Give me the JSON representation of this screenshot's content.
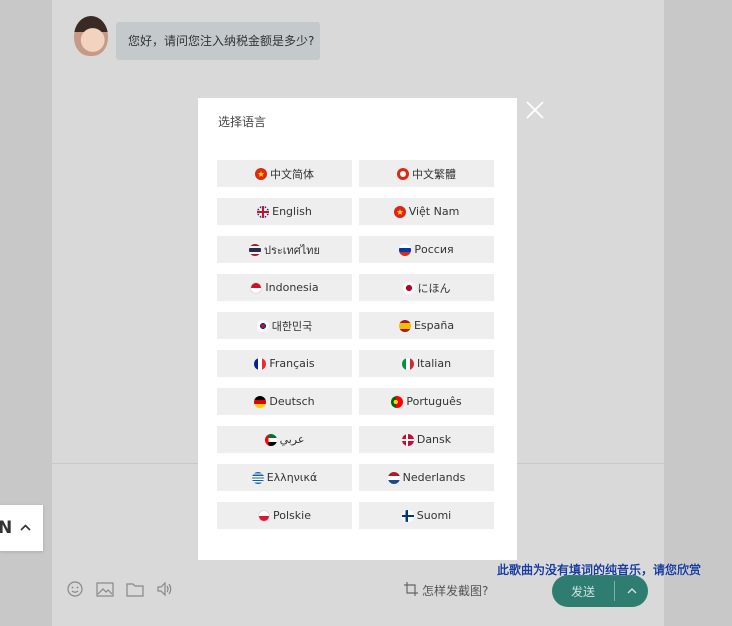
{
  "chat": {
    "bubble_text": "您好，请问您注入纳税金额是多少?"
  },
  "toolbar": {
    "screenshot_hint": "怎样发截图?",
    "send_label": "发送"
  },
  "notice_text": "此歌曲为没有填词的纯音乐，请您欣赏",
  "language_switch": {
    "code": "N"
  },
  "modal": {
    "title": "选择语言",
    "languages": [
      {
        "label": "中文简体",
        "flag": "china-flag-icon"
      },
      {
        "label": "中文繁體",
        "flag": "hongkong-flag-icon"
      },
      {
        "label": "English",
        "flag": "uk-flag-icon"
      },
      {
        "label": "Việt Nam",
        "flag": "vietnam-flag-icon"
      },
      {
        "label": "ประเทศไทย",
        "flag": "thailand-flag-icon"
      },
      {
        "label": "Россия",
        "flag": "russia-flag-icon"
      },
      {
        "label": "Indonesia",
        "flag": "indonesia-flag-icon"
      },
      {
        "label": "にほん",
        "flag": "japan-flag-icon"
      },
      {
        "label": "대한민국",
        "flag": "korea-flag-icon"
      },
      {
        "label": "España",
        "flag": "spain-flag-icon"
      },
      {
        "label": "Français",
        "flag": "france-flag-icon"
      },
      {
        "label": "Italian",
        "flag": "italy-flag-icon"
      },
      {
        "label": "Deutsch",
        "flag": "germany-flag-icon"
      },
      {
        "label": "Português",
        "flag": "portugal-flag-icon"
      },
      {
        "label": "عربي",
        "flag": "uae-flag-icon"
      },
      {
        "label": "Dansk",
        "flag": "denmark-flag-icon"
      },
      {
        "label": "Ελληνικά",
        "flag": "greece-flag-icon"
      },
      {
        "label": "Nederlands",
        "flag": "netherlands-flag-icon"
      },
      {
        "label": "Polskie",
        "flag": "poland-flag-icon"
      },
      {
        "label": "Suomi",
        "flag": "finland-flag-icon"
      }
    ]
  },
  "colors": {
    "overlay": "#c8c8c8",
    "send_button": "#2e7d70",
    "notice": "#1a3c9c"
  }
}
